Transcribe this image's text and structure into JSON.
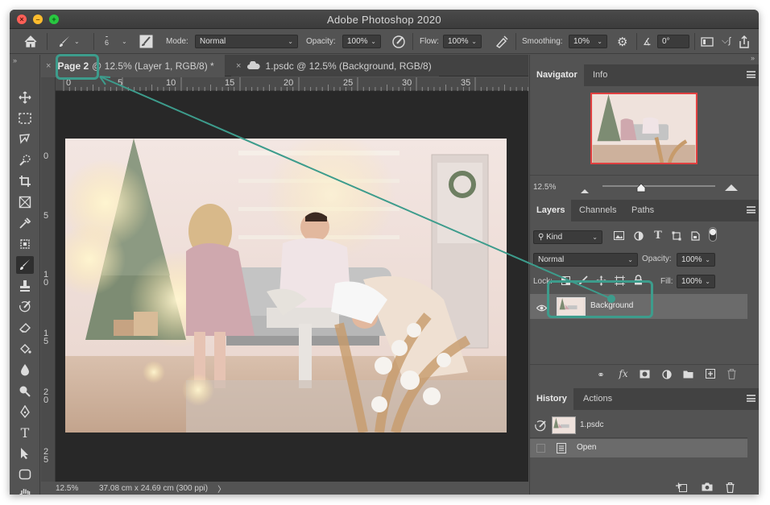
{
  "app": {
    "title": "Adobe Photoshop 2020"
  },
  "options_bar": {
    "brush_size": "6",
    "mode_label": "Mode:",
    "mode_value": "Normal",
    "opacity_label": "Opacity:",
    "opacity_value": "100%",
    "flow_label": "Flow:",
    "flow_value": "100%",
    "smoothing_label": "Smoothing:",
    "smoothing_value": "10%",
    "angle_value": "0°"
  },
  "tabs": [
    {
      "title_prefix": "Page 2",
      "title_rest": "@ 12.5% (Layer 1, RGB/8) *"
    },
    {
      "title": "1.psdc @ 12.5% (Background, RGB/8)"
    }
  ],
  "ruler": {
    "h_ticks": [
      "0",
      "5",
      "10",
      "15",
      "20",
      "25",
      "30",
      "35"
    ],
    "v_ticks": [
      "0",
      "5",
      "1\n0",
      "1\n5",
      "2\n0",
      "2\n5"
    ]
  },
  "status": {
    "zoom": "12.5%",
    "doc_size": "37.08 cm x 24.69 cm (300 ppi)",
    "more": "〉"
  },
  "navigator": {
    "tab": "Navigator",
    "tab2": "Info",
    "zoom": "12.5%"
  },
  "layers_panel": {
    "tabs": [
      "Layers",
      "Channels",
      "Paths"
    ],
    "filter_kind": "Kind",
    "blend_mode": "Normal",
    "opacity_label": "Opacity:",
    "opacity_value": "100%",
    "lock_label": "Lock:",
    "fill_label": "Fill:",
    "fill_value": "100%",
    "layers": [
      {
        "name": "Background",
        "visible": true
      }
    ]
  },
  "history_panel": {
    "tabs": [
      "History",
      "Actions"
    ],
    "snapshot": "1.psdc",
    "items": [
      "Open"
    ]
  },
  "colors": {
    "accent": "#3d9c8c"
  }
}
